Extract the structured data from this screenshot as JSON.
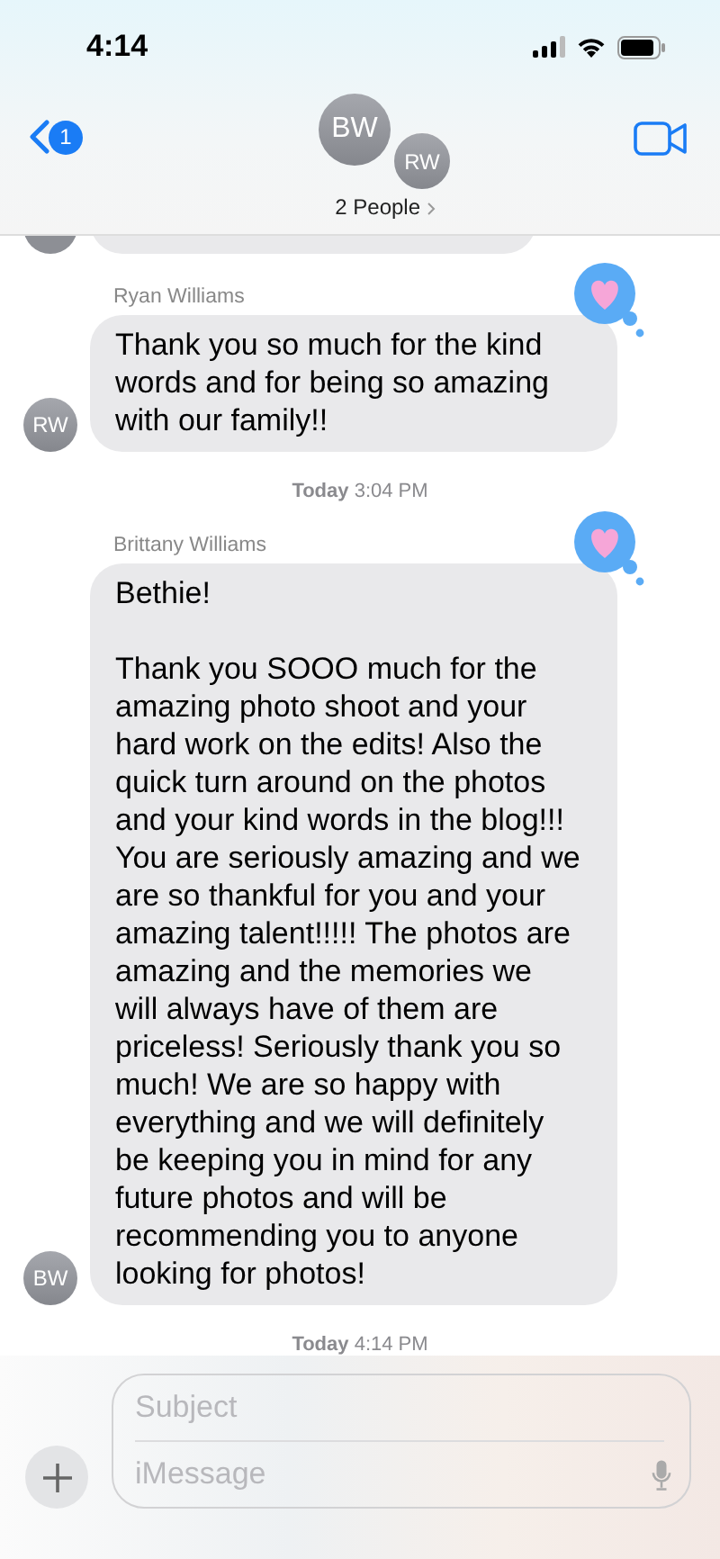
{
  "status_bar": {
    "time": "4:14"
  },
  "header": {
    "back_badge": "1",
    "avatars": [
      {
        "initials": "BW"
      },
      {
        "initials": "RW"
      }
    ],
    "people_label": "2 People"
  },
  "messages": [
    {
      "kind": "partial"
    },
    {
      "kind": "message",
      "sender": "Ryan Williams",
      "avatar": "RW",
      "text": "Thank you so much for the kind words and for being so amazing with our family!!",
      "reacted": true
    },
    {
      "kind": "timestamp",
      "text": "**Today** 3:04 PM"
    },
    {
      "kind": "message",
      "sender": "Brittany Williams",
      "avatar": "BW",
      "text": "Bethie!\n\nThank you SOOO much for the amazing photo shoot and your hard work on the edits! Also the quick turn around on the photos and your kind words in the blog!!! You are seriously amazing and we are so thankful for you and your amazing talent!!!!! The photos are amazing and the memories we will always have of them are priceless! Seriously thank you so much! We are so happy with everything and we will definitely be keeping you in mind for any future photos and will be recommending you to anyone looking for photos!",
      "reacted": true
    },
    {
      "kind": "timestamp",
      "text": "**Today** 4:14 PM"
    }
  ],
  "composer": {
    "subject_placeholder": "Subject",
    "message_placeholder": "iMessage"
  }
}
